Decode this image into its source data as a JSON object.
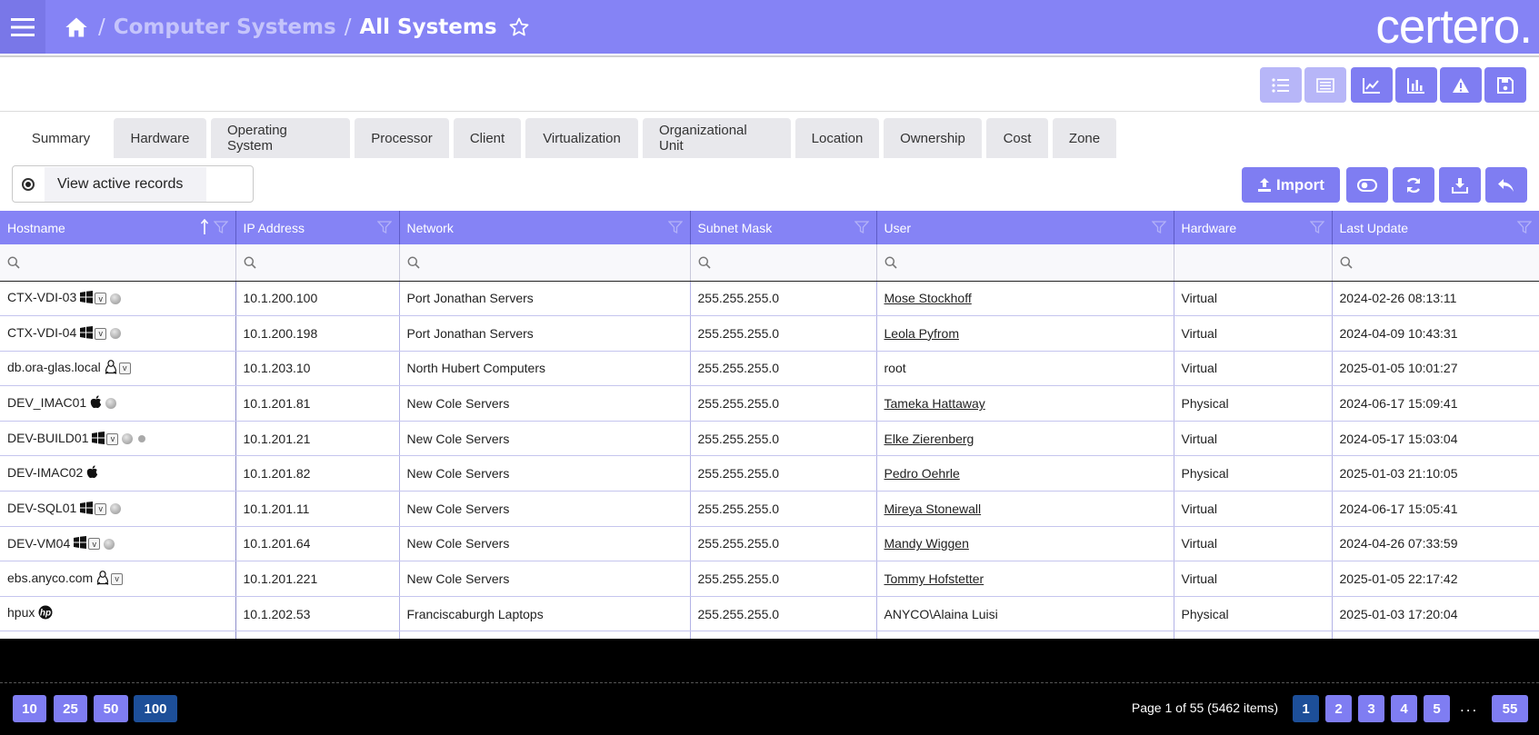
{
  "header": {
    "breadcrumb_parent": "Computer Systems",
    "breadcrumb_separator": "/",
    "breadcrumb_current": "All Systems",
    "logo_text": "certero."
  },
  "tabs": [
    {
      "label": "Summary",
      "active": true
    },
    {
      "label": "Hardware"
    },
    {
      "label": "Operating System"
    },
    {
      "label": "Processor"
    },
    {
      "label": "Client"
    },
    {
      "label": "Virtualization"
    },
    {
      "label": "Organizational Unit"
    },
    {
      "label": "Location"
    },
    {
      "label": "Ownership"
    },
    {
      "label": "Cost"
    },
    {
      "label": "Zone"
    }
  ],
  "view_records": {
    "label": "View active records",
    "selected": true
  },
  "actions": {
    "import_label": "Import"
  },
  "grid": {
    "columns": [
      "Hostname",
      "IP Address",
      "Network",
      "Subnet Mask",
      "User",
      "Hardware",
      "Last Update"
    ],
    "rows": [
      {
        "hostname": "CTX-VDI-03",
        "os": "windows-icon",
        "virtual": true,
        "status": true,
        "ip": "10.1.200.100",
        "network": "Port Jonathan Servers",
        "subnet": "255.255.255.0",
        "user": "Mose Stockhoff",
        "user_link": true,
        "hardware": "Virtual",
        "last_update": "2024-02-26 08:13:11"
      },
      {
        "hostname": "CTX-VDI-04",
        "os": "windows-icon",
        "virtual": true,
        "status": true,
        "ip": "10.1.200.198",
        "network": "Port Jonathan Servers",
        "subnet": "255.255.255.0",
        "user": "Leola Pyfrom",
        "user_link": true,
        "hardware": "Virtual",
        "last_update": "2024-04-09 10:43:31"
      },
      {
        "hostname": "db.ora-glas.local",
        "os": "linux-icon",
        "virtual": true,
        "status": false,
        "ip": "10.1.203.10",
        "network": "North Hubert Computers",
        "subnet": "255.255.255.0",
        "user": "root",
        "user_link": false,
        "hardware": "Virtual",
        "last_update": "2025-01-05 10:01:27"
      },
      {
        "hostname": "DEV_IMAC01",
        "os": "apple-icon",
        "virtual": false,
        "status": true,
        "ip": "10.1.201.81",
        "network": "New Cole Servers",
        "subnet": "255.255.255.0",
        "user": "Tameka Hattaway",
        "user_link": true,
        "hardware": "Physical",
        "last_update": "2024-06-17 15:09:41"
      },
      {
        "hostname": "DEV-BUILD01",
        "os": "windows-icon",
        "virtual": true,
        "status": true,
        "extra_dot": true,
        "ip": "10.1.201.21",
        "network": "New Cole Servers",
        "subnet": "255.255.255.0",
        "user": "Elke Zierenberg",
        "user_link": true,
        "hardware": "Virtual",
        "last_update": "2024-05-17 15:03:04"
      },
      {
        "hostname": "DEV-IMAC02",
        "os": "apple-icon",
        "virtual": false,
        "status": false,
        "ip": "10.1.201.82",
        "network": "New Cole Servers",
        "subnet": "255.255.255.0",
        "user": "Pedro Oehrle",
        "user_link": true,
        "hardware": "Physical",
        "last_update": "2025-01-03 21:10:05"
      },
      {
        "hostname": "DEV-SQL01",
        "os": "windows-icon",
        "virtual": true,
        "status": true,
        "ip": "10.1.201.11",
        "network": "New Cole Servers",
        "subnet": "255.255.255.0",
        "user": "Mireya Stonewall",
        "user_link": true,
        "hardware": "Virtual",
        "last_update": "2024-06-17 15:05:41"
      },
      {
        "hostname": "DEV-VM04",
        "os": "windows-icon",
        "virtual": true,
        "status": true,
        "ip": "10.1.201.64",
        "network": "New Cole Servers",
        "subnet": "255.255.255.0",
        "user": "Mandy Wiggen",
        "user_link": true,
        "hardware": "Virtual",
        "last_update": "2024-04-26 07:33:59"
      },
      {
        "hostname": "ebs.anyco.com",
        "os": "linux-icon",
        "virtual": true,
        "status": false,
        "ip": "10.1.201.221",
        "network": "New Cole Servers",
        "subnet": "255.255.255.0",
        "user": "Tommy Hofstetter",
        "user_link": true,
        "hardware": "Virtual",
        "last_update": "2025-01-05 22:17:42"
      },
      {
        "hostname": "hpux",
        "os": "hp-icon",
        "virtual": false,
        "status": false,
        "ip": "10.1.202.53",
        "network": "Franciscaburgh Laptops",
        "subnet": "255.255.255.0",
        "user": "ANYCO\\Alaina Luisi",
        "user_link": false,
        "hardware": "Physical",
        "last_update": "2025-01-03 17:20:04"
      }
    ]
  },
  "pagination": {
    "page_sizes": [
      "10",
      "25",
      "50",
      "100"
    ],
    "selected_page_size": "100",
    "info": "Page 1 of 55 (5462 items)",
    "pages": [
      "1",
      "2",
      "3",
      "4",
      "5"
    ],
    "ellipsis": "...",
    "last_page": "55",
    "current_page": "1"
  },
  "colors": {
    "primary": "#8583f5",
    "button": "#7f7df2",
    "selected": "#1d4f99"
  }
}
